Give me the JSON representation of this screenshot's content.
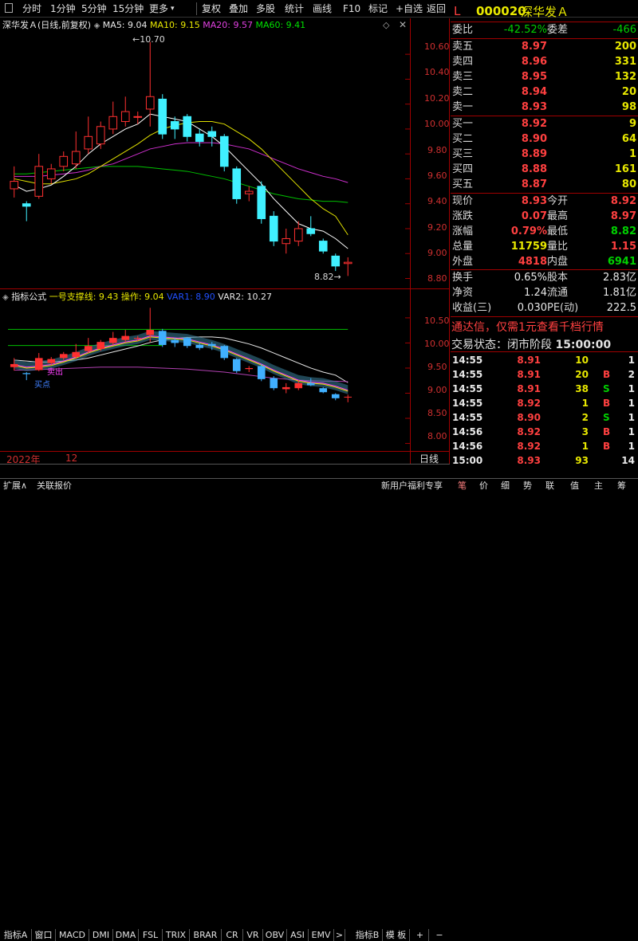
{
  "toolbar": {
    "left": [
      "分时",
      "1分钟",
      "5分钟",
      "15分钟",
      "更多"
    ],
    "right": [
      "复权",
      "叠加",
      "多股",
      "统计",
      "画线",
      "F10",
      "标记",
      "+自选",
      "返回"
    ]
  },
  "chart_title": {
    "name": "深华发Ａ",
    "mode": "(日线,前复权)",
    "ma5": "MA5: 9.04",
    "ma10": "MA10: 9.15",
    "ma20": "MA20: 9.57",
    "ma60": "MA60: 9.41"
  },
  "chart_marks": {
    "high": "10.70",
    "low": "8.82"
  },
  "price_axis": [
    "10.60",
    "10.40",
    "10.20",
    "10.00",
    "9.80",
    "9.60",
    "9.40",
    "9.20",
    "9.00",
    "8.80"
  ],
  "indicator": {
    "title": "指标公式",
    "line1": "一号支撑线: 9.43",
    "op": "操作: 9.04",
    "var1": "VAR1: 8.90",
    "var2": "VAR2: 10.27",
    "sell": "卖出",
    "buy": "买点"
  },
  "ind_axis": [
    "10.50",
    "10.00",
    "9.50",
    "9.00",
    "8.50",
    "8.00"
  ],
  "date_bar": {
    "year": "2022年",
    "month": "12",
    "period": "日线"
  },
  "tabs": [
    "指标A",
    "窗口",
    "MACD",
    "DMI",
    "DMA",
    "FSL",
    "TRIX",
    "BRAR",
    "CR",
    "VR",
    "OBV",
    "ASI",
    "EMV",
    ">"
  ],
  "tabs_right": [
    "指标B",
    "模 板",
    "+",
    "−"
  ],
  "bottom": {
    "left": [
      "扩展∧",
      "关联报价"
    ],
    "promo": "新用户福利专享",
    "right": [
      "笔",
      "价",
      "细",
      "势",
      "联",
      "值",
      "主",
      "筹"
    ]
  },
  "quote": {
    "flag": "L",
    "code": "000020",
    "name": "深华发Ａ",
    "weibi_label": "委比",
    "weibi": "-42.52%",
    "weicha_label": "委差",
    "weicha": "-466",
    "asks": [
      {
        "l": "卖五",
        "p": "8.97",
        "v": "200"
      },
      {
        "l": "卖四",
        "p": "8.96",
        "v": "331"
      },
      {
        "l": "卖三",
        "p": "8.95",
        "v": "132"
      },
      {
        "l": "卖二",
        "p": "8.94",
        "v": "20"
      },
      {
        "l": "卖一",
        "p": "8.93",
        "v": "98"
      }
    ],
    "bids": [
      {
        "l": "买一",
        "p": "8.92",
        "v": "9"
      },
      {
        "l": "买二",
        "p": "8.90",
        "v": "64"
      },
      {
        "l": "买三",
        "p": "8.89",
        "v": "1"
      },
      {
        "l": "买四",
        "p": "8.88",
        "v": "161"
      },
      {
        "l": "买五",
        "p": "8.87",
        "v": "80"
      }
    ],
    "stats": [
      {
        "l1": "现价",
        "v1": "8.93",
        "c1": "red",
        "l2": "今开",
        "v2": "8.92",
        "c2": "red"
      },
      {
        "l1": "涨跌",
        "v1": "0.07",
        "c1": "red",
        "l2": "最高",
        "v2": "8.97",
        "c2": "red"
      },
      {
        "l1": "涨幅",
        "v1": "0.79%",
        "c1": "red",
        "l2": "最低",
        "v2": "8.82",
        "c2": "green"
      },
      {
        "l1": "总量",
        "v1": "11759",
        "c1": "yellow",
        "l2": "量比",
        "v2": "1.15",
        "c2": "red"
      },
      {
        "l1": "外盘",
        "v1": "4818",
        "c1": "red",
        "l2": "内盘",
        "v2": "6941",
        "c2": "green"
      }
    ],
    "stats2": [
      {
        "l1": "换手",
        "v1": "0.65%",
        "l2": "股本",
        "v2": "2.83亿"
      },
      {
        "l1": "净资",
        "v1": "1.24",
        "l2": "流通",
        "v2": "1.81亿"
      },
      {
        "l1": "收益(三)",
        "v1": "0.030",
        "l2": "PE(动)",
        "v2": "222.5"
      }
    ],
    "promo": "通达信，仅需1元查看千档行情",
    "trade_status": "交易状态：闭市阶段",
    "trade_time": "15:00:00",
    "ticks": [
      {
        "t": "14:55",
        "p": "8.91",
        "v": "10",
        "d": "",
        "pc": "red",
        "vc": "yellow"
      },
      {
        "t": "14:55",
        "p": "8.91",
        "v": "20",
        "d": "B",
        "pc": "red",
        "vc": "yellow"
      },
      {
        "t": "14:55",
        "p": "8.91",
        "v": "38",
        "d": "S",
        "pc": "red",
        "vc": "yellow"
      },
      {
        "t": "14:55",
        "p": "8.92",
        "v": "1",
        "d": "B",
        "pc": "red",
        "vc": "yellow"
      },
      {
        "t": "14:55",
        "p": "8.90",
        "v": "2",
        "d": "S",
        "pc": "red",
        "vc": "yellow"
      },
      {
        "t": "14:56",
        "p": "8.92",
        "v": "3",
        "d": "B",
        "pc": "red",
        "vc": "yellow"
      },
      {
        "t": "14:56",
        "p": "8.92",
        "v": "1",
        "d": "B",
        "pc": "red",
        "vc": "yellow"
      },
      {
        "t": "15:00",
        "p": "8.93",
        "v": "93",
        "d": "",
        "pc": "red",
        "vc": "yellow"
      }
    ],
    "tick_side": [
      "1",
      "2",
      "1",
      "1",
      "1",
      "1",
      "1",
      "14"
    ]
  },
  "chart_data": {
    "type": "candlestick",
    "title": "深华发Ａ (日线,前复权)",
    "ylim": [
      8.72,
      10.78
    ],
    "ohlc": [
      [
        9.52,
        9.7,
        9.45,
        9.58
      ],
      [
        9.4,
        9.42,
        9.26,
        9.38
      ],
      [
        9.46,
        9.8,
        9.44,
        9.7
      ],
      [
        9.6,
        9.72,
        9.56,
        9.68
      ],
      [
        9.7,
        9.82,
        9.66,
        9.78
      ],
      [
        9.72,
        9.98,
        9.68,
        9.82
      ],
      [
        9.84,
        10.1,
        9.8,
        9.94
      ],
      [
        9.88,
        10.06,
        9.84,
        10.02
      ],
      [
        10.0,
        10.22,
        9.96,
        10.1
      ],
      [
        10.06,
        10.26,
        10.02,
        10.14
      ],
      [
        10.1,
        10.14,
        10.04,
        10.1
      ],
      [
        10.16,
        10.7,
        10.02,
        10.26
      ],
      [
        10.24,
        10.28,
        9.92,
        9.96
      ],
      [
        10.06,
        10.1,
        9.92,
        10.0
      ],
      [
        10.1,
        10.12,
        9.9,
        9.94
      ],
      [
        9.96,
        10.0,
        9.86,
        9.9
      ],
      [
        9.98,
        10.02,
        9.86,
        9.94
      ],
      [
        9.94,
        9.96,
        9.66,
        9.7
      ],
      [
        9.68,
        9.7,
        9.4,
        9.44
      ],
      [
        9.48,
        9.54,
        9.42,
        9.5
      ],
      [
        9.54,
        9.58,
        9.24,
        9.28
      ],
      [
        9.3,
        9.34,
        9.06,
        9.1
      ],
      [
        9.08,
        9.2,
        9.0,
        9.12
      ],
      [
        9.1,
        9.26,
        9.06,
        9.2
      ],
      [
        9.2,
        9.3,
        9.14,
        9.16
      ],
      [
        9.1,
        9.12,
        9.0,
        9.02
      ],
      [
        8.98,
        9.0,
        8.86,
        8.9
      ],
      [
        8.92,
        8.97,
        8.82,
        8.93
      ]
    ],
    "ma5": [
      9.55,
      9.5,
      9.52,
      9.55,
      9.62,
      9.7,
      9.8,
      9.88,
      9.94,
      10.0,
      10.04,
      10.12,
      10.1,
      10.08,
      10.06,
      10.0,
      9.94,
      9.86,
      9.76,
      9.66,
      9.56,
      9.44,
      9.34,
      9.24,
      9.2,
      9.18,
      9.12,
      9.04
    ],
    "ma10": [
      9.6,
      9.58,
      9.56,
      9.56,
      9.58,
      9.6,
      9.64,
      9.7,
      9.76,
      9.82,
      9.88,
      9.95,
      10.0,
      10.03,
      10.05,
      10.06,
      10.06,
      10.04,
      9.98,
      9.92,
      9.84,
      9.74,
      9.64,
      9.54,
      9.44,
      9.36,
      9.3,
      9.15
    ],
    "ma20": [
      9.62,
      9.62,
      9.62,
      9.63,
      9.64,
      9.65,
      9.67,
      9.7,
      9.72,
      9.76,
      9.8,
      9.84,
      9.86,
      9.88,
      9.89,
      9.89,
      9.89,
      9.88,
      9.86,
      9.84,
      9.8,
      9.76,
      9.72,
      9.68,
      9.65,
      9.62,
      9.6,
      9.57
    ],
    "ma60": [
      9.64,
      9.64,
      9.65,
      9.66,
      9.67,
      9.68,
      9.69,
      9.7,
      9.7,
      9.7,
      9.7,
      9.69,
      9.68,
      9.67,
      9.66,
      9.64,
      9.62,
      9.6,
      9.57,
      9.54,
      9.51,
      9.48,
      9.46,
      9.44,
      9.43,
      9.42,
      9.42,
      9.41
    ]
  }
}
